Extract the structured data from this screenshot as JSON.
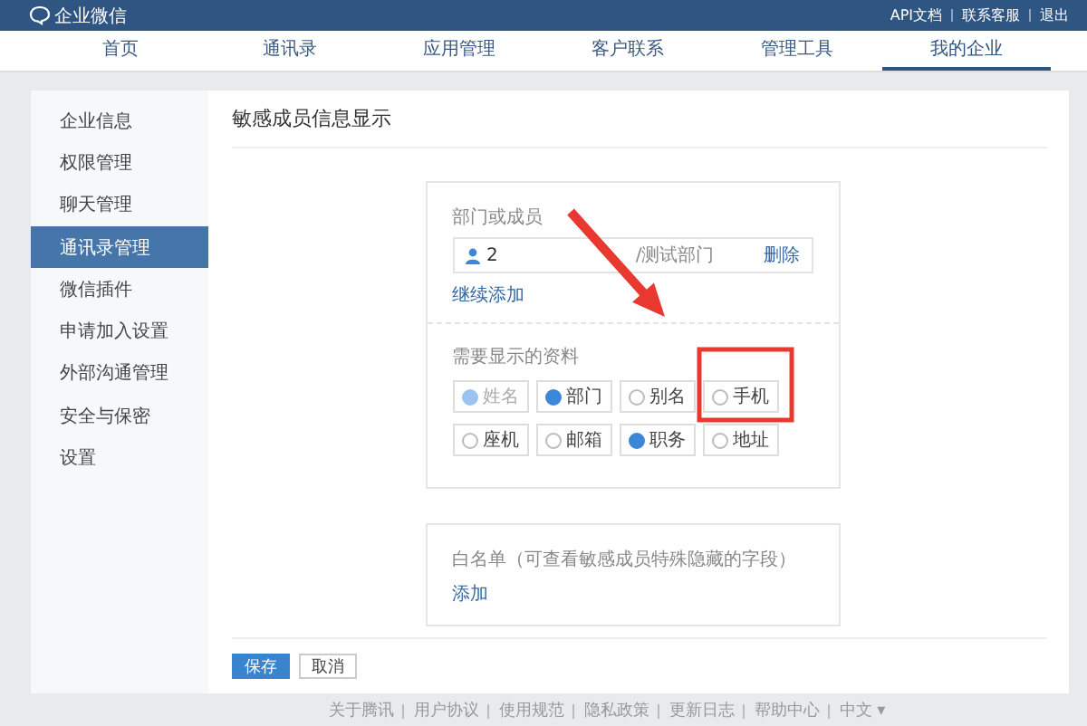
{
  "top_bar": {
    "logo": "企业微信",
    "links": [
      "API文档",
      "联系客服",
      "退出"
    ]
  },
  "nav_tabs": [
    {
      "label": "首页",
      "selected": false
    },
    {
      "label": "通讯录",
      "selected": false
    },
    {
      "label": "应用管理",
      "selected": false
    },
    {
      "label": "客户联系",
      "selected": false
    },
    {
      "label": "管理工具",
      "selected": false
    },
    {
      "label": "我的企业",
      "selected": true
    }
  ],
  "sidebar": {
    "items": [
      {
        "label": "企业信息",
        "selected": false
      },
      {
        "label": "权限管理",
        "selected": false
      },
      {
        "label": "聊天管理",
        "selected": false
      },
      {
        "label": "通讯录管理",
        "selected": true
      },
      {
        "label": "微信插件",
        "selected": false
      },
      {
        "label": "申请加入设置",
        "selected": false
      },
      {
        "label": "外部沟通管理",
        "selected": false
      },
      {
        "label": "安全与保密",
        "selected": false
      },
      {
        "label": "设置",
        "selected": false
      }
    ]
  },
  "page_title": "敏感成员信息显示",
  "scope": {
    "label": "部门或成员",
    "member": {
      "count": "2",
      "department": "/测试部门",
      "action": "删除"
    },
    "add_more": "继续添加"
  },
  "fields": {
    "label": "需要显示的资料",
    "options": [
      {
        "label": "姓名",
        "checked": true,
        "disabled": true
      },
      {
        "label": "部门",
        "checked": true,
        "disabled": false
      },
      {
        "label": "别名",
        "checked": false,
        "disabled": false
      },
      {
        "label": "手机",
        "checked": false,
        "disabled": false
      },
      {
        "label": "座机",
        "checked": false,
        "disabled": false
      },
      {
        "label": "邮箱",
        "checked": false,
        "disabled": false
      },
      {
        "label": "职务",
        "checked": true,
        "disabled": false
      },
      {
        "label": "地址",
        "checked": false,
        "disabled": false
      }
    ]
  },
  "whitelist": {
    "label": "白名单（可查看敏感成员特殊隐藏的字段）",
    "add": "添加"
  },
  "buttons": [
    {
      "label": "保存",
      "kind": "primary"
    },
    {
      "label": "取消",
      "kind": "secondary"
    }
  ],
  "footer": [
    "关于腾讯",
    "用户协议",
    "使用规范",
    "隐私政策",
    "更新日志",
    "帮助中心",
    "中文 ▾"
  ]
}
